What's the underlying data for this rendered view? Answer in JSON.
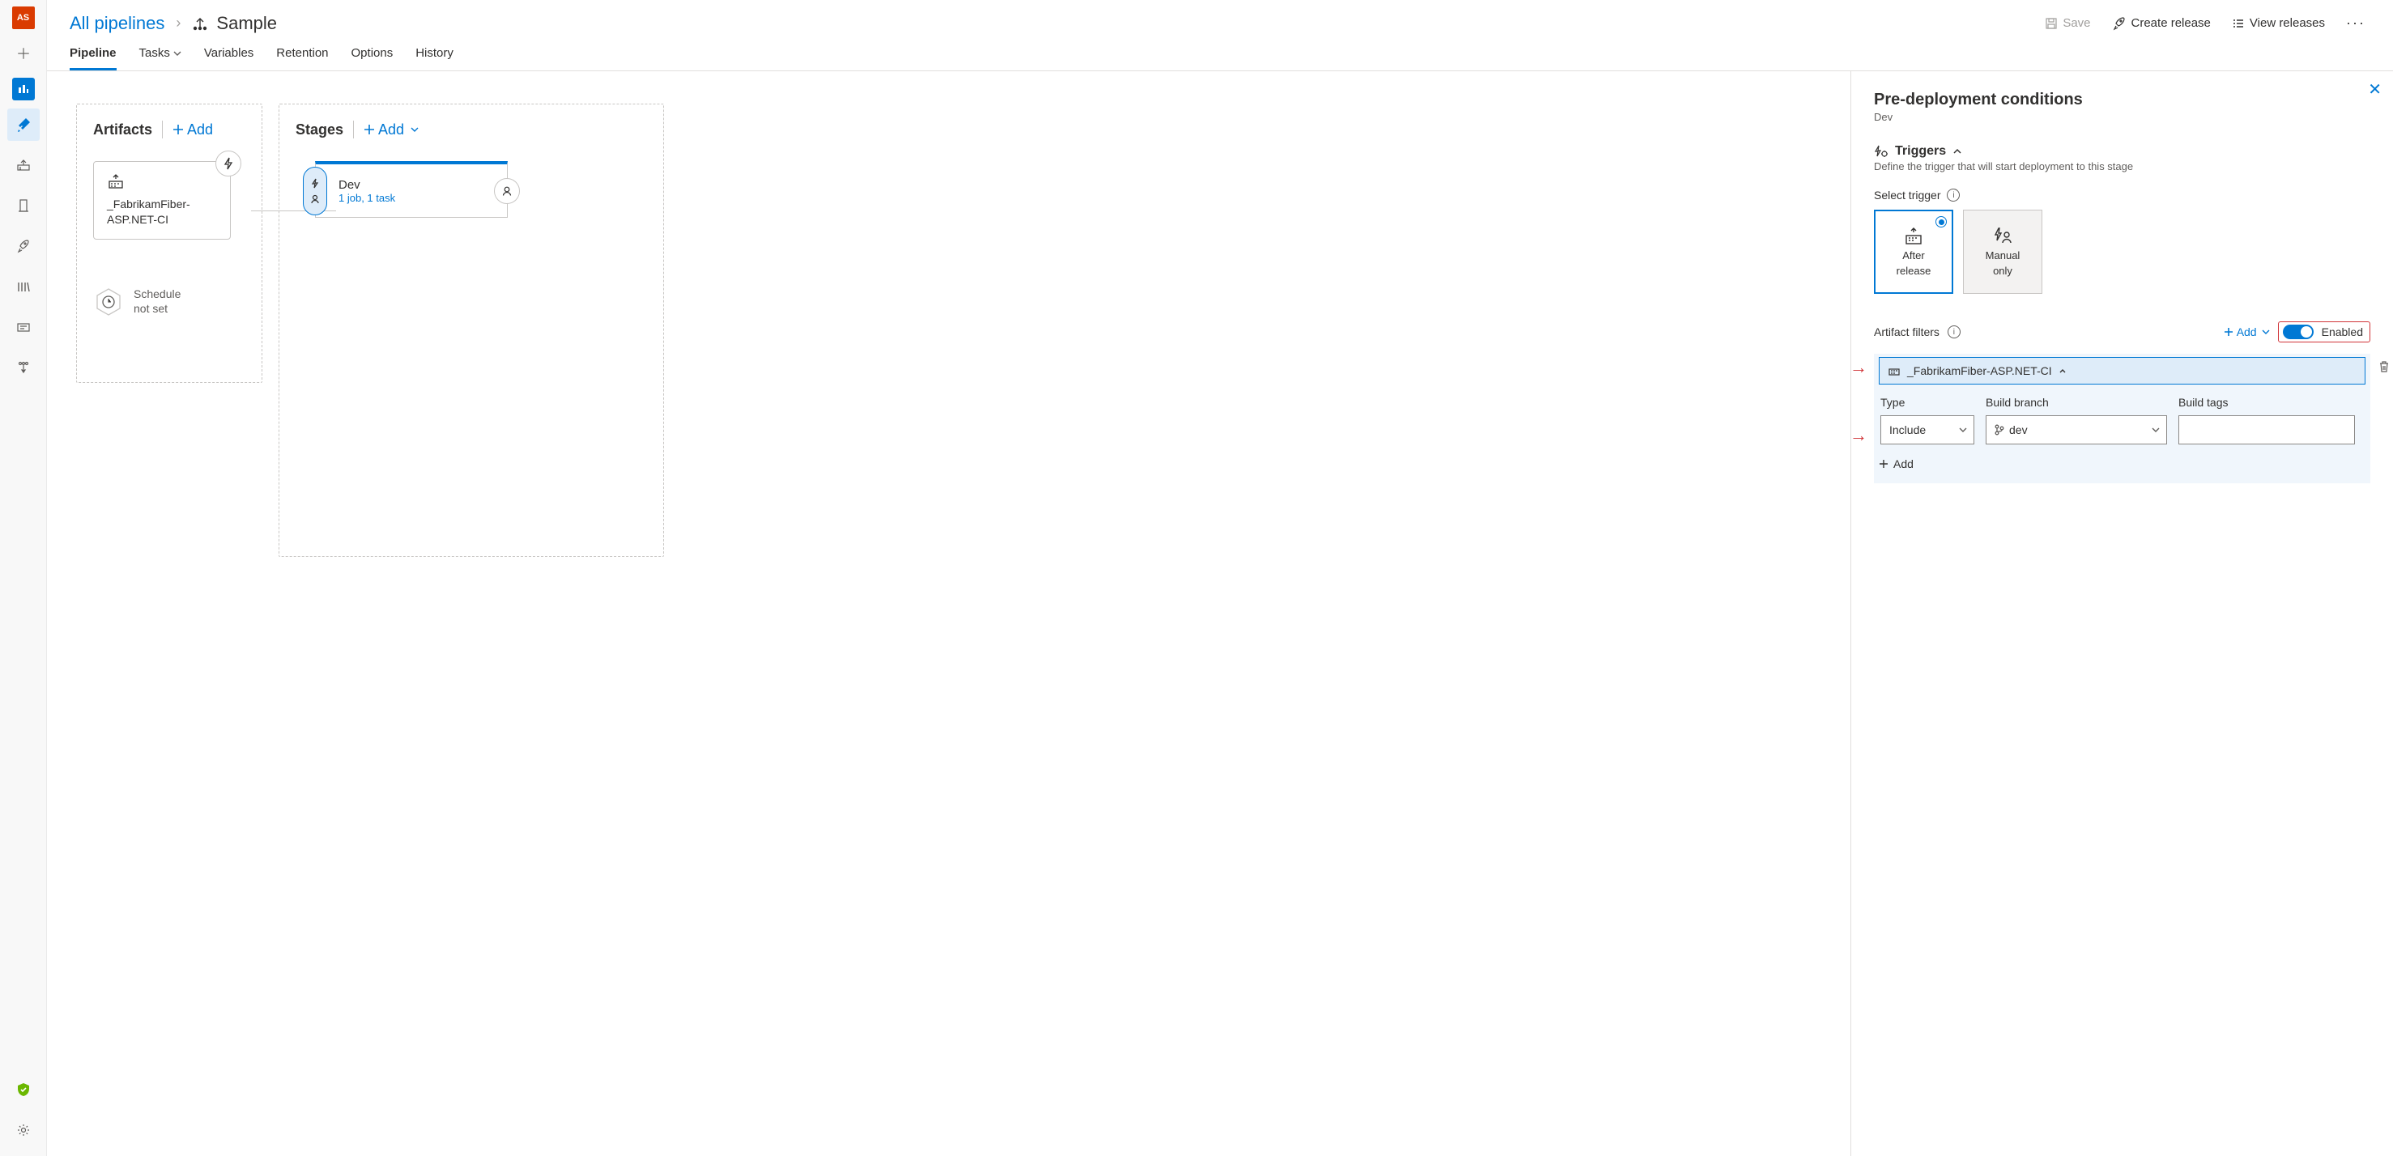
{
  "rail": {
    "avatar": "AS"
  },
  "breadcrumb": {
    "root": "All pipelines",
    "title": "Sample"
  },
  "commands": {
    "save": "Save",
    "create_release": "Create release",
    "view_releases": "View releases"
  },
  "tabs": {
    "pipeline": "Pipeline",
    "tasks": "Tasks",
    "variables": "Variables",
    "retention": "Retention",
    "options": "Options",
    "history": "History"
  },
  "canvas": {
    "artifacts": {
      "title": "Artifacts",
      "add": "Add",
      "item_name": "_FabrikamFiber-ASP.NET-CI",
      "schedule_l1": "Schedule",
      "schedule_l2": "not set"
    },
    "stages": {
      "title": "Stages",
      "add": "Add",
      "stage_name": "Dev",
      "stage_sub": "1 job, 1 task"
    }
  },
  "panel": {
    "title": "Pre-deployment conditions",
    "subtitle": "Dev",
    "triggers": {
      "head": "Triggers",
      "desc": "Define the trigger that will start deployment to this stage",
      "select_label": "Select trigger",
      "after_l1": "After",
      "after_l2": "release",
      "manual_l1": "Manual",
      "manual_l2": "only"
    },
    "filters": {
      "head": "Artifact filters",
      "add": "Add",
      "enabled": "Enabled",
      "artifact_name": "_FabrikamFiber-ASP.NET-CI",
      "col_type": "Type",
      "col_branch": "Build branch",
      "col_tags": "Build tags",
      "type_value": "Include",
      "branch_value": "dev",
      "add_row": "Add"
    }
  }
}
